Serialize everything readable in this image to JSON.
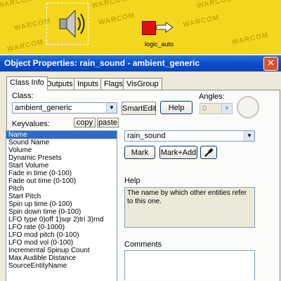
{
  "viewport": {
    "watermark": "WARCOM",
    "entity_label": "logic_auto"
  },
  "dialog": {
    "title": "Object Properties: rain_sound - ambient_generic",
    "close_glyph": "✕",
    "tabs": [
      "Class Info",
      "Outputs",
      "Inputs",
      "Flags",
      "VisGroup"
    ],
    "class_label": "Class:",
    "class_value": "ambient_generic",
    "smartedit_label": "SmartEdit",
    "help_button_label": "Help",
    "angles_label": "Angles:",
    "angles_value": "0",
    "keyvalues_label": "Keyvalues:",
    "copy_label": "copy",
    "paste_label": "paste",
    "keyvalues": [
      "Name",
      "Sound Name",
      "Volume",
      "Dynamic Presets",
      "Start Volume",
      "Fade in time (0-100)",
      "Fade out time (0-100)",
      "Pitch",
      "Start Pitch",
      "Spin up time (0-100)",
      "Spin down time (0-100)",
      "LFO type 0)off 1)sqr 2)tri 3)rnd",
      "LFO rate (0-1000)",
      "LFO mod pitch (0-100)",
      "LFO mod vol (0-100)",
      "Incremental Spinup Count",
      "Max Audible Distance",
      "SourceEntityName"
    ],
    "selected_key": "Name",
    "value_field": "rain_sound",
    "mark_label": "Mark",
    "mark_add_label": "Mark+Add",
    "help_heading": "Help",
    "help_text": "The name by which other entities refer to this one.",
    "comments_heading": "Comments"
  },
  "colors": {
    "viewport_bg": "#f2d71e",
    "titlebar": "#0a4dcc",
    "selection": "#316ac5"
  },
  "icons": [
    "speaker-icon",
    "logic-auto-entity-icon",
    "close-icon",
    "dropdown-arrow-icon",
    "eyedropper-icon"
  ]
}
